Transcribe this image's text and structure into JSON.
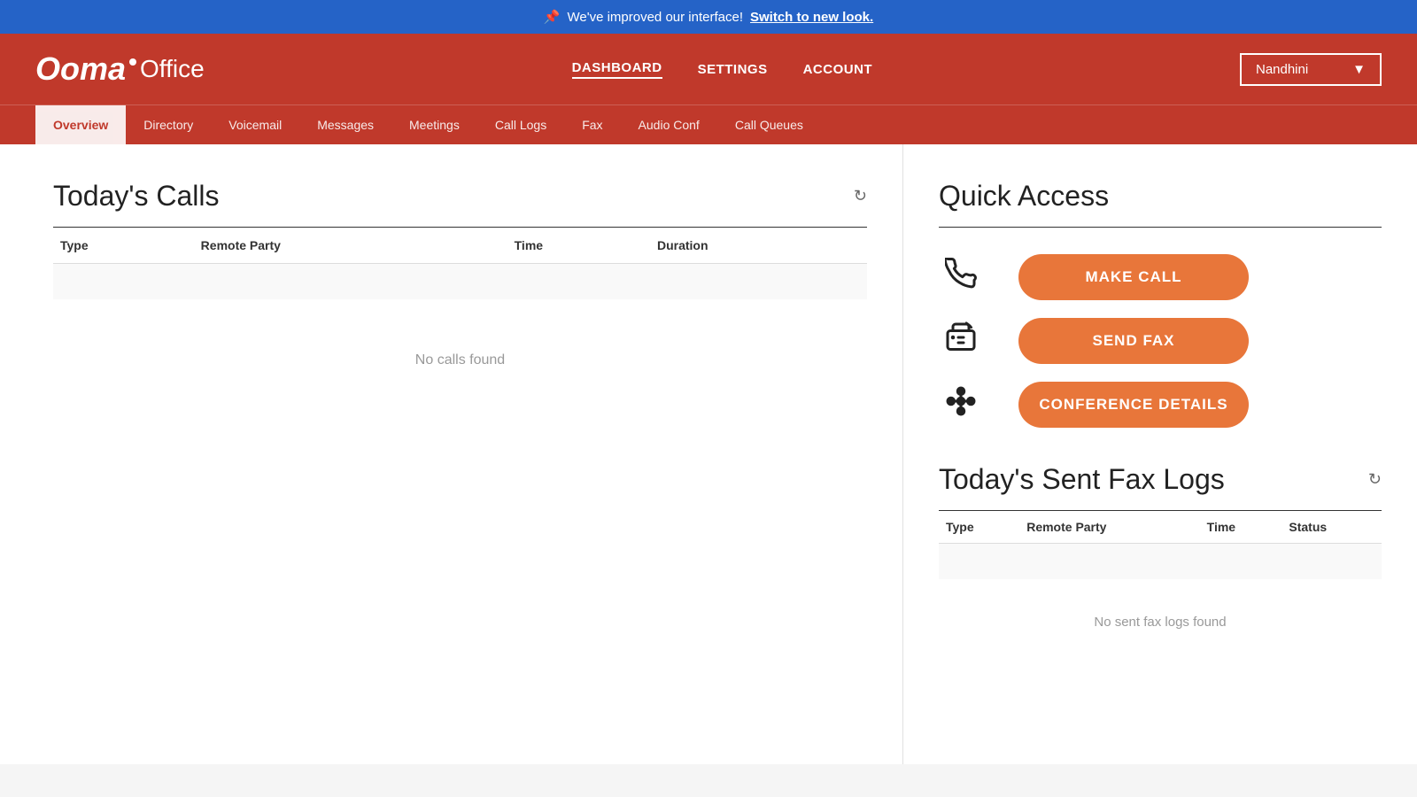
{
  "banner": {
    "message": "We've improved our interface!",
    "link_text": "Switch to new look.",
    "icon": "📌"
  },
  "header": {
    "logo_ooma": "Ooma",
    "logo_office": "Office",
    "nav": {
      "dashboard": "DASHBOARD",
      "settings": "SETTINGS",
      "account": "ACCOUNT"
    },
    "user": "Nandhini"
  },
  "sub_nav": {
    "items": [
      {
        "label": "Overview",
        "active": true
      },
      {
        "label": "Directory",
        "active": false
      },
      {
        "label": "Voicemail",
        "active": false
      },
      {
        "label": "Messages",
        "active": false
      },
      {
        "label": "Meetings",
        "active": false
      },
      {
        "label": "Call Logs",
        "active": false
      },
      {
        "label": "Fax",
        "active": false
      },
      {
        "label": "Audio Conf",
        "active": false
      },
      {
        "label": "Call Queues",
        "active": false
      }
    ]
  },
  "calls_section": {
    "title": "Today's Calls",
    "columns": [
      "Type",
      "Remote Party",
      "Time",
      "Duration"
    ],
    "no_data_message": "No calls found"
  },
  "quick_access": {
    "title": "Quick Access",
    "buttons": [
      {
        "label": "MAKE CALL",
        "icon": "phone"
      },
      {
        "label": "SEND FAX",
        "icon": "fax"
      },
      {
        "label": "CONFERENCE DETAILS",
        "icon": "conference"
      }
    ]
  },
  "fax_logs_section": {
    "title": "Today's Sent Fax Logs",
    "columns": [
      "Type",
      "Remote Party",
      "Time",
      "Status"
    ],
    "no_data_message": "No sent fax logs found"
  },
  "colors": {
    "primary_red": "#c0392b",
    "primary_blue": "#2563c7",
    "button_orange": "#e8763a"
  }
}
